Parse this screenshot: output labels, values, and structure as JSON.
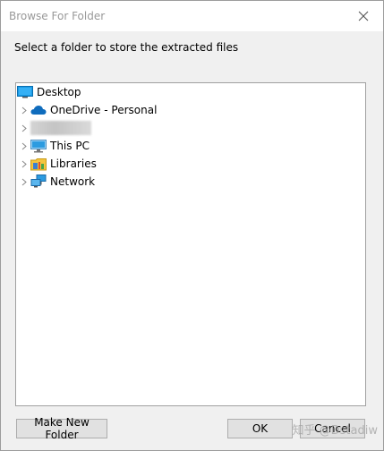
{
  "window": {
    "title": "Browse For Folder",
    "instruction": "Select a folder to store the extracted files"
  },
  "tree": {
    "root": {
      "label": "Desktop",
      "icon": "desktop-icon"
    },
    "items": [
      {
        "label": "OneDrive - Personal",
        "icon": "onedrive-cloud-icon",
        "expandable": true
      },
      {
        "label": "",
        "icon": "user-folder-icon",
        "expandable": true,
        "obscured": true
      },
      {
        "label": "This PC",
        "icon": "this-pc-icon",
        "expandable": true
      },
      {
        "label": "Libraries",
        "icon": "libraries-icon",
        "expandable": true
      },
      {
        "label": "Network",
        "icon": "network-icon",
        "expandable": true
      }
    ]
  },
  "buttons": {
    "make_new_folder": "Make New Folder",
    "ok": "OK",
    "cancel": "Cancel"
  },
  "watermark": "知乎 @Dstadiw"
}
